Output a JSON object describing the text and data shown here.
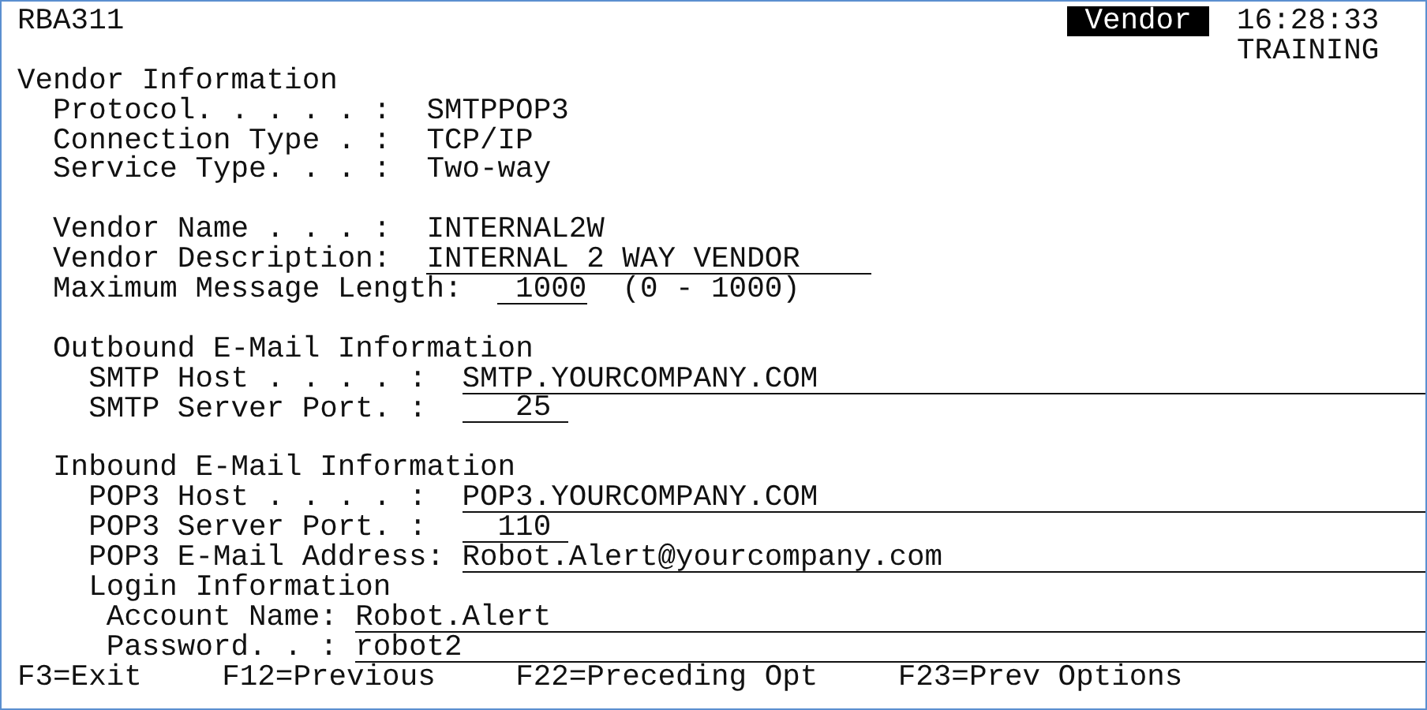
{
  "header": {
    "program": "RBA311",
    "title": "Vendor",
    "time": "16:28:33",
    "environment": "TRAINING"
  },
  "vendor_information": {
    "heading": "Vendor Information",
    "connection": [
      {
        "label": "Protocol. . . . . :",
        "value": "SMTPPOP3",
        "kind": "output"
      },
      {
        "label": "Connection Type . :",
        "value": "TCP/IP",
        "kind": "output"
      },
      {
        "label": "Service Type. . . :",
        "value": "Two-way",
        "kind": "output"
      }
    ],
    "vendor": [
      {
        "label": "Vendor Name . . . :",
        "value": "INTERNAL2W",
        "kind": "output"
      },
      {
        "label": "Vendor Description:",
        "value": "INTERNAL 2 WAY VENDOR",
        "kind": "input"
      },
      {
        "label": "Maximum Message Length:",
        "value": "1000",
        "kind": "count",
        "range": "(0 - 1000)"
      }
    ]
  },
  "outbound": {
    "heading": "Outbound E-Mail Information",
    "fields": [
      {
        "label": "SMTP Host . . . . :",
        "value": "SMTP.YOURCOMPANY.COM",
        "kind": "input-long"
      },
      {
        "label": "SMTP Server Port. :",
        "value": "25",
        "kind": "port"
      }
    ]
  },
  "inbound": {
    "heading": "Inbound E-Mail Information",
    "fields": [
      {
        "label": "POP3 Host . . . . :",
        "value": "POP3.YOURCOMPANY.COM",
        "kind": "input-long"
      },
      {
        "label": "POP3 Server Port. :",
        "value": "110",
        "kind": "port"
      },
      {
        "label": "POP3 E-Mail Address:",
        "value": "Robot.Alert@yourcompany.com",
        "kind": "input-long"
      }
    ],
    "login": {
      "heading": "Login Information",
      "fields": [
        {
          "label": "Account Name:",
          "value": "Robot.Alert",
          "kind": "input-long"
        },
        {
          "label": "Password. . :",
          "value": "robot2",
          "kind": "input-long"
        }
      ]
    }
  },
  "function_keys": [
    "F3=Exit",
    "F12=Previous",
    "F22=Preceding Opt",
    "F23=Prev Options"
  ]
}
